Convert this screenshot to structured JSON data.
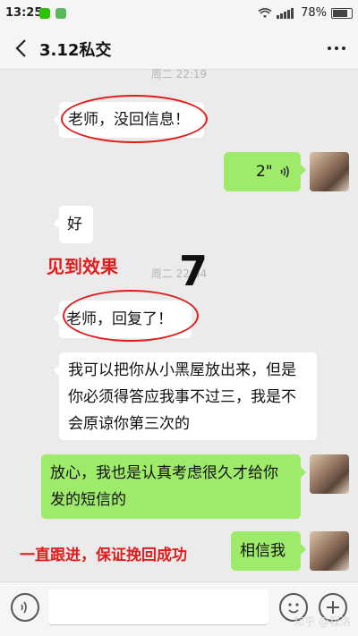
{
  "status_bar": {
    "time": "13:25",
    "battery": "78%",
    "battery_level": 0.78,
    "network": "4G"
  },
  "header": {
    "title": "3.12私交"
  },
  "messages": [
    {
      "side": "time",
      "text": "周二 22:19"
    },
    {
      "side": "left",
      "text": "老师，没回信息！"
    },
    {
      "side": "right",
      "text": "2\""
    },
    {
      "side": "left",
      "text": "好"
    },
    {
      "side": "time",
      "text": "周二 22:54"
    },
    {
      "side": "left",
      "text": "老师，回复了！"
    },
    {
      "side": "left",
      "text": "我可以把你从小黑屋放出来，但是你必须得答应我事不过三，我是不会原谅你第三次的"
    },
    {
      "side": "right",
      "text": "放心，我也是认真考虑很久才给你发的短信的"
    },
    {
      "side": "right",
      "text": "相信我"
    }
  ],
  "annotations": {
    "seen_effect": "见到效果",
    "number": "7",
    "follow_up": "一直跟进，保证挽回成功"
  },
  "watermark": "知乎 @程洛",
  "colors": {
    "chat_bg": "#ebebeb",
    "bubble_right": "#9eea6a",
    "bubble_left": "#ffffff",
    "annotation_red": "#e11c1c"
  }
}
